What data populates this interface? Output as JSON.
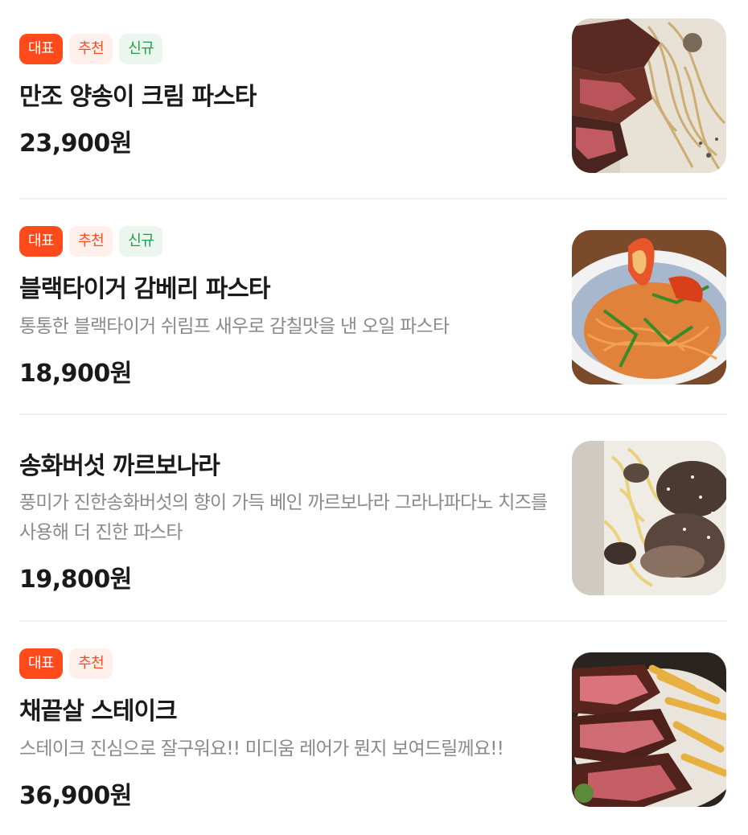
{
  "menu_items": [
    {
      "badges": {
        "rep": "대표",
        "rec": "추천",
        "new": "신규"
      },
      "name": "만조 양송이 크림 파스타",
      "description": "",
      "price": "23,900원",
      "image": "steak-cream-pasta-photo"
    },
    {
      "badges": {
        "rep": "대표",
        "rec": "추천",
        "new": "신규"
      },
      "name": "블랙타이거 감베리 파스타",
      "description": "통통한 블랙타이거 쉬림프 새우로 감칠맛을 낸 오일 파스타",
      "price": "18,900원",
      "image": "shrimp-oil-pasta-photo"
    },
    {
      "badges": {},
      "name": "송화버섯 까르보나라",
      "description": "풍미가 진한송화버섯의 향이 가득 베인 까르보나라 그라나파다노 치즈를 사용해 더 진한 파스타",
      "price": "19,800원",
      "image": "mushroom-carbonara-photo"
    },
    {
      "badges": {
        "rep": "대표",
        "rec": "추천"
      },
      "name": "채끝살 스테이크",
      "description": "스테이크 진심으로 잘구워요!! 미디움 레어가 뭔지 보여드릴께요!!",
      "price": "36,900원",
      "image": "sirloin-steak-fries-photo"
    }
  ],
  "colors": {
    "badge_rep_bg": "#ff4a1c",
    "badge_rec_bg": "#fff0ec",
    "badge_new_bg": "#eaf6ee",
    "text_primary": "#1a1a1a",
    "text_secondary": "#8a8a8a"
  }
}
